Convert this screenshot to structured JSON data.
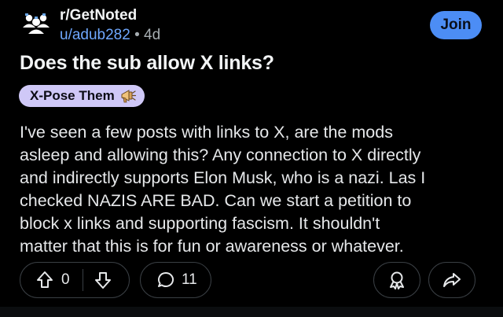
{
  "header": {
    "subreddit": "r/GetNoted",
    "username": "u/adub282",
    "separator": "•",
    "age": "4d",
    "join_label": "Join"
  },
  "post": {
    "title": "Does the sub allow X links?",
    "flair": {
      "label": "X-Pose Them",
      "emoji_icon": "megaphone-icon",
      "color": "#cfc8f7"
    },
    "body_lines": [
      "I've seen a few posts with links to X, are the mods",
      "asleep and allowing this? Any connection to X directly",
      "and indirectly supports Elon Musk, who is a nazi. Las I",
      "checked NAZIS ARE BAD. Can we start a petition to",
      "block x links and supporting fascism. It shouldn't",
      "matter that this is for fun or awareness or whatever."
    ]
  },
  "actions": {
    "vote_count": "0",
    "comment_count": "11",
    "upvote_icon": "arrow-up-icon",
    "downvote_icon": "arrow-down-icon",
    "comment_icon": "speech-bubble-icon",
    "award_icon": "award-icon",
    "share_icon": "share-arrow-icon"
  },
  "colors": {
    "background": "#000000",
    "accent": "#4c8df5",
    "username": "#6fa8ff",
    "border": "#3a3f44"
  }
}
